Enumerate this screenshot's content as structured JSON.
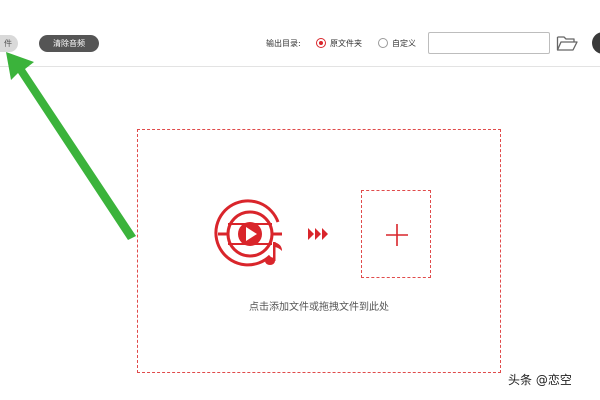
{
  "toolbar": {
    "left_button_label": "件",
    "clear_button_label": "清除音频",
    "output_label": "输出目录:",
    "output_options": [
      {
        "label": "原文件夹",
        "checked": true
      },
      {
        "label": "自定义",
        "checked": false
      }
    ],
    "path_value": "",
    "path_placeholder": ""
  },
  "drop_zone": {
    "hint": "点击添加文件或拖拽文件到此处"
  },
  "watermark": "头条 @恋空",
  "colors": {
    "accent": "#d9252b",
    "dashed_border": "#e04b4b",
    "annotation_arrow": "#3bb33b",
    "pill_dark": "#555555"
  },
  "icons": {
    "media": "video-music-disc-icon",
    "arrows": "triple-chevron-right-icon",
    "add": "plus-icon",
    "folder": "folder-open-icon"
  }
}
